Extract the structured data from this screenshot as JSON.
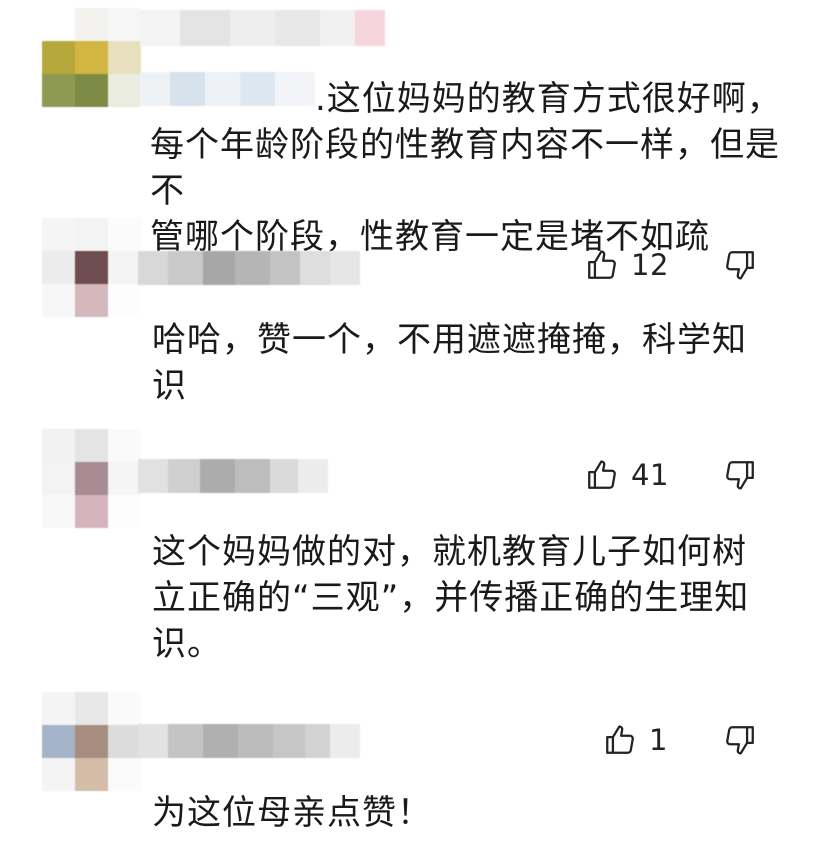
{
  "comments": [
    {
      "text": ".这位妈妈的教育方式很好啊，\n每个年龄阶段的性教育内容不一样，但是不\n管哪个阶段，性教育一定是堵不如疏"
    },
    {
      "like_count": "12",
      "text": "哈哈，赞一个，不用遮遮掩掩，科学知\n识"
    },
    {
      "like_count": "41",
      "text": "这个妈妈做的对，就机教育儿子如何树\n立正确的“三观”，并传播正确的生理知\n识。"
    },
    {
      "like_count": "1",
      "text": "为这位母亲点赞！"
    }
  ],
  "icons": {
    "like": "thumbs-up-icon",
    "dislike": "thumbs-down-icon"
  },
  "colors": {
    "text": "#1a1a1a",
    "icon_stroke": "#222222",
    "background": "#ffffff"
  }
}
